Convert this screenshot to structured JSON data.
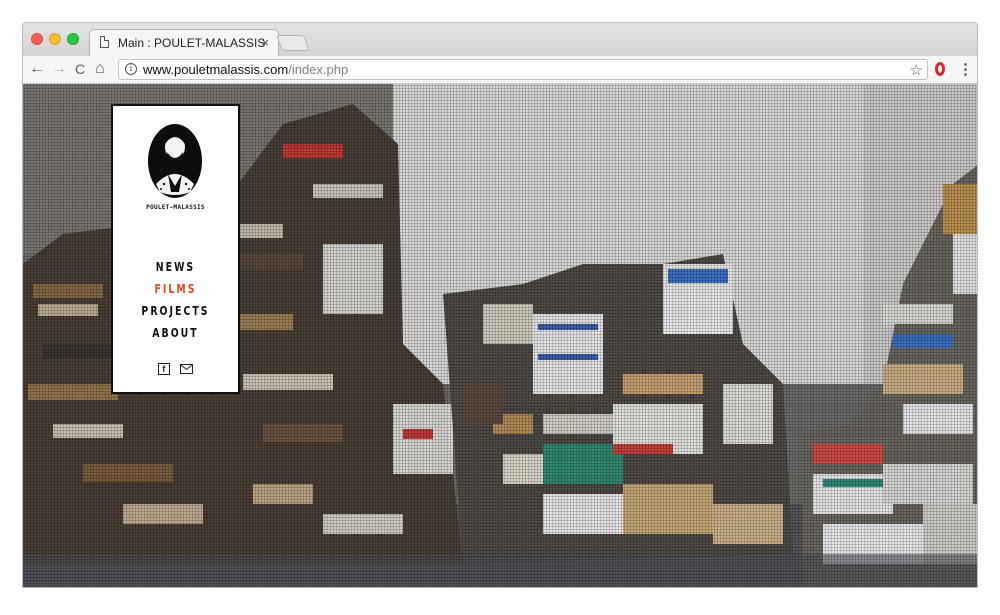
{
  "browser": {
    "tab_title": "Main : POULET-MALASSIS",
    "tab_close": "×",
    "url_host": "www.pouletmalassis.com",
    "url_path": "/index.php",
    "nav": {
      "back": "←",
      "forward": "→",
      "reload": "C",
      "home": "⌂"
    },
    "star": "☆",
    "menu": "⋮"
  },
  "site": {
    "logo_text": "POULET—MALASSIS",
    "menu": [
      {
        "label": "NEWS",
        "active": false
      },
      {
        "label": "FILMS",
        "active": true
      },
      {
        "label": "PROJECTS",
        "active": false
      },
      {
        "label": "ABOUT",
        "active": false
      }
    ],
    "social": {
      "facebook": "f"
    },
    "accent_color": "#e8471a"
  }
}
